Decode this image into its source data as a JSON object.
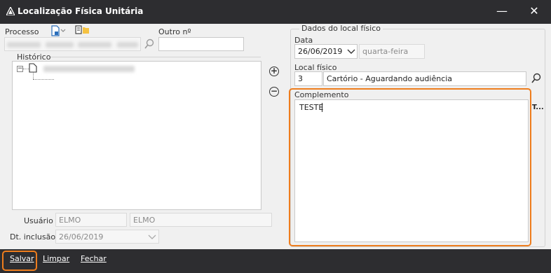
{
  "window": {
    "title": "Localização Física Unitária",
    "minimize": "—",
    "close": "✕"
  },
  "left": {
    "processo_label": "Processo",
    "outro_label": "Outro nº",
    "historico_label": "Histórico",
    "usuario_label": "Usuário",
    "usuario_code": "ELMO",
    "usuario_name": "ELMO",
    "dtinclusao_label": "Dt. inclusão",
    "dtinclusao_value": "26/06/2019"
  },
  "right": {
    "group_title": "Dados do local físico",
    "data_label": "Data",
    "data_value": "26/06/2019",
    "weekday": "quarta-feira",
    "local_label": "Local físico",
    "local_code": "3",
    "local_name": "Cartório - Aguardando audiência",
    "complemento_label": "Complemento",
    "complemento_value": "TESTE",
    "side_truncated": "T..."
  },
  "toolbar": {
    "salvar": "Salvar",
    "limpar": "Limpar",
    "fechar": "Fechar"
  }
}
